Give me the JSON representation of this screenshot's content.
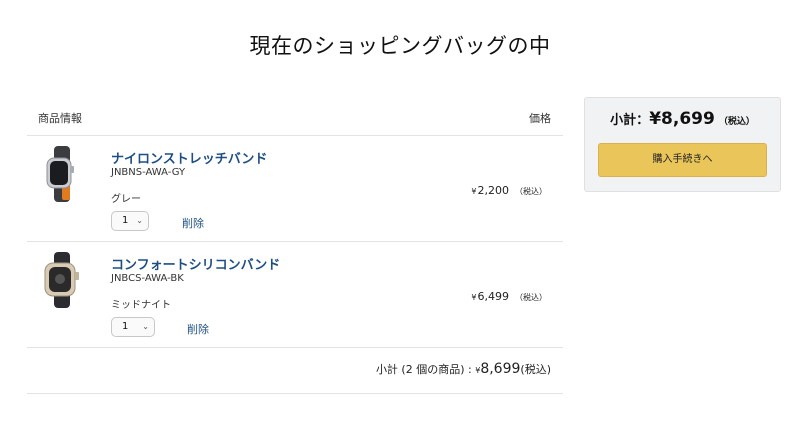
{
  "page": {
    "title": "現在のショッピングバッグの中"
  },
  "cart": {
    "header": {
      "product_info": "商品情報",
      "price": "価格"
    },
    "items": [
      {
        "name": "ナイロンストレッチバンド",
        "sku": "JNBNS-AWA-GY",
        "variant": "グレー",
        "quantity": "1",
        "delete_label": "削除",
        "price_symbol": "¥",
        "price": "2,200",
        "tax_note": "（税込）",
        "image_icon": "watch-nylon-band-icon"
      },
      {
        "name": "コンフォートシリコンバンド",
        "sku": "JNBCS-AWA-BK",
        "variant": "ミッドナイト",
        "quantity": "1",
        "delete_label": "削除",
        "price_symbol": "¥",
        "price": "6,499",
        "tax_note": "（税込）",
        "image_icon": "watch-silicone-band-icon"
      }
    ],
    "subtotal": {
      "label": "小計 (2 個の商品) :",
      "symbol": "¥",
      "amount": "8,699",
      "tax_note": "(税込)"
    }
  },
  "summary": {
    "label": "小計：",
    "symbol": "¥",
    "amount": "8,699",
    "tax_note": "（税込）",
    "checkout_label": "購入手続きへ"
  },
  "colors": {
    "link": "#1f4f82",
    "checkout_button": "#eac55a",
    "summary_bg": "#f1f2f3"
  }
}
